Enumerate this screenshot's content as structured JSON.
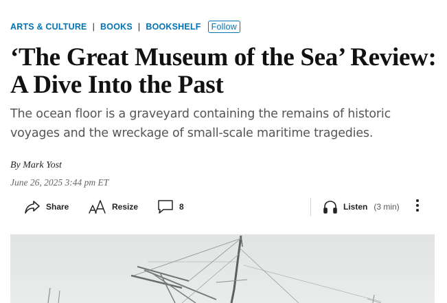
{
  "breadcrumb": {
    "items": [
      {
        "label": "ARTS & CULTURE"
      },
      {
        "label": "BOOKS"
      },
      {
        "label": "BOOKSHELF"
      }
    ],
    "separator": "|",
    "follow_label": "Follow"
  },
  "article": {
    "headline": "‘The Great Museum of the Sea’ Review: A Dive Into the Past",
    "dek": "The ocean floor is a graveyard containing the remains of historic voyages and the wreckage of small-scale maritime tragedies.",
    "byline_prefix": "By",
    "author": "Mark Yost",
    "timestamp": "June 26, 2025 3:44 pm ET"
  },
  "toolbar": {
    "share_label": "Share",
    "resize_label": "Resize",
    "comment_count": "8",
    "listen_label": "Listen",
    "listen_duration": "(3 min)"
  },
  "icons": {
    "share": "share-arrow-icon",
    "resize": "text-resize-icon",
    "comments": "comment-bubble-icon",
    "listen": "headphones-icon",
    "more": "vertical-ellipsis-icon"
  },
  "colors": {
    "link_blue": "#0274b6",
    "headline": "#111111",
    "dek": "#555555",
    "image_bg": "#e6e8e7"
  }
}
